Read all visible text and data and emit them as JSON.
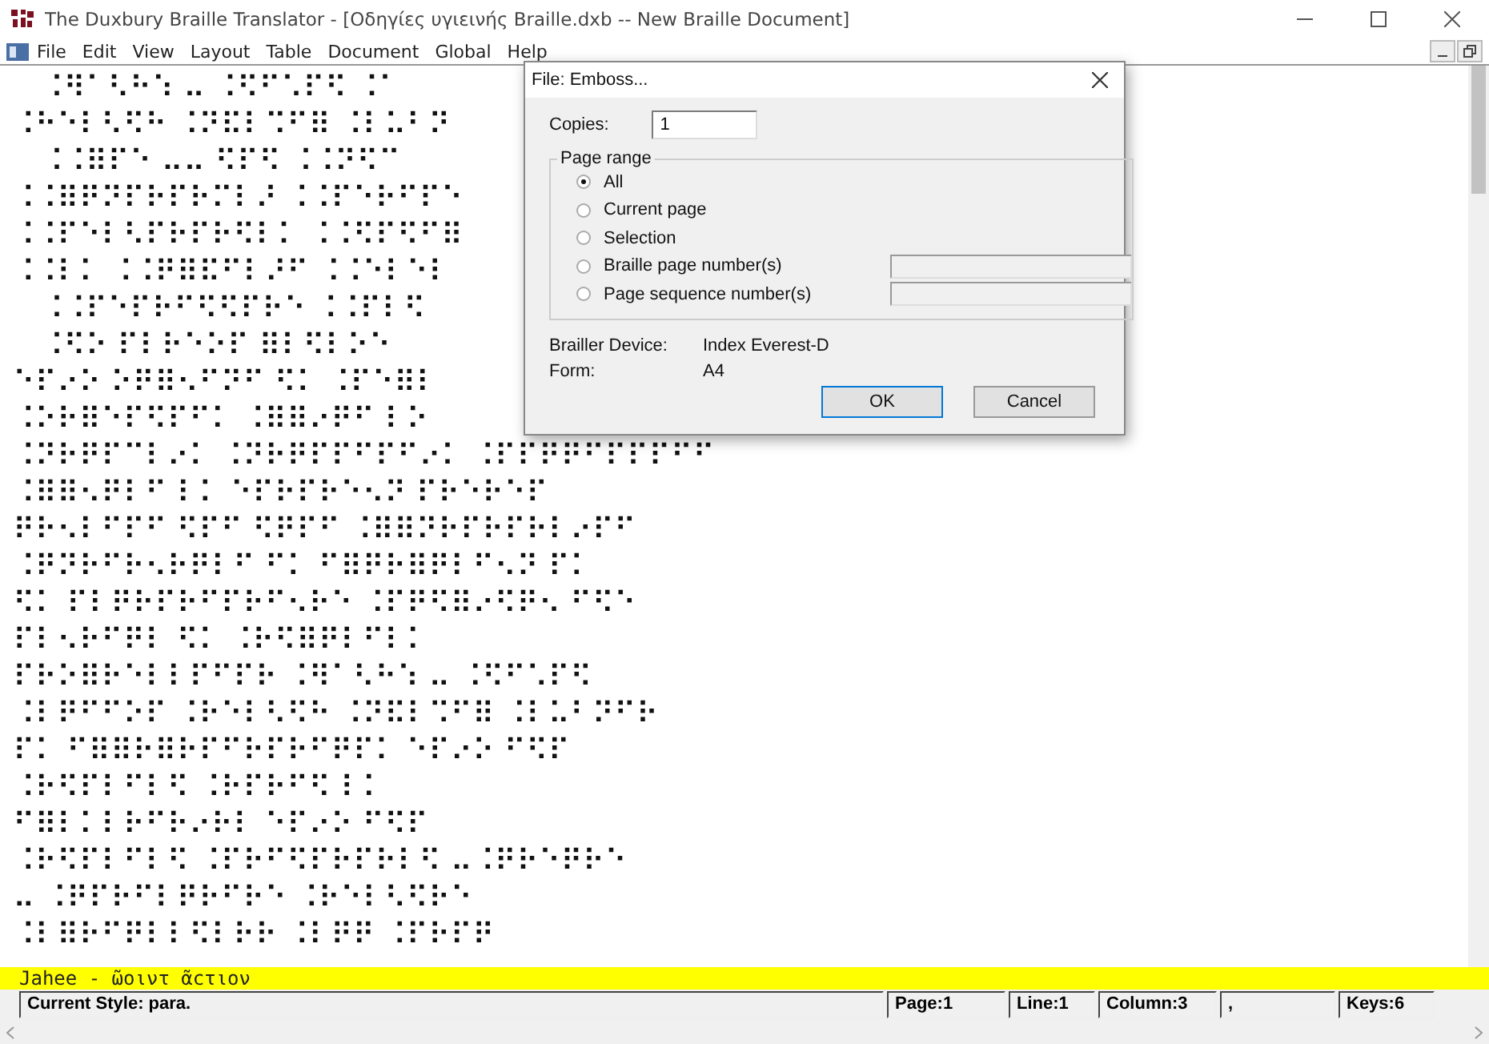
{
  "window": {
    "title": "The Duxbury Braille Translator - [Οδηγίες υγιεινής Braille.dxb -- New Braille Document]"
  },
  "menu": [
    "File",
    "Edit",
    "View",
    "Layout",
    "Table",
    "Document",
    "Global",
    "Help"
  ],
  "document": {
    "lines": [
      "   ⠨⠻⠁⠣⠓⠱ ⠤ ⠨⠫⠋⠡⠏⠫ ⠨⠁",
      "⠨⠓⠑⠇⠣⠫⠓ ⠨⠝⠯⠇⠩⠋⠿ ⠨⠇⠥⠃⠝",
      "   ⠨⠨⠿⠏⠑ ⠤⠤ ⠫⠏⠫ ⠨⠨⠝⠫⠉",
      "⠨⠨⠿⠟⠝⠏⠗⠏⠗⠍⠇⠜ ⠨⠨⠏⠑⠗⠋⠏⠑",
      "⠨⠨⠏⠑⠇⠣⠏⠗⠏⠗⠫⠇⠅ ⠨⠨⠫⠏⠫⠋⠿",
      "⠨⠨⠇⠅ ⠨⠨⠟⠿⠯⠋⠇⠜⠋ ⠨⠨⠑⠇⠑⠇",
      "   ⠨⠨⠏⠑⠏⠗⠋⠫⠫⠏⠗⠑ ⠨⠨⠏⠇⠫",
      "   ⠨⠫⠕ ⠏⠇⠗⠑⠕⠏ ⠿⠇⠫⠇⠕⠑",
      "⠑⠏⠔⠕ ⠕⠟⠿⠢⠋⠝⠋ ⠫⠅ ⠨⠏⠑⠿⠇",
      "⠨⠕⠗⠿⠑⠏⠫⠏⠋⠅ ⠨⠿⠿⠔⠟⠋ ⠇⠕",
      "⠨⠝⠗⠟⠏⠉⠇⠔⠅ ⠨⠝⠗⠟⠏⠏⠋⠏⠋⠔⠅ ⠨⠏⠏⠟⠟⠋⠏⠏⠏⠋⠋",
      "⠨⠿⠿⠢⠟⠇⠋ ⠇⠅ ⠑⠏⠗⠏⠗⠑⠢⠝ ⠏⠗⠑⠗⠑⠏",
      "⠟⠗⠢⠇⠋⠏⠋ ⠫⠏⠋ ⠫⠟⠏⠋ ⠨⠿⠿⠝⠗⠏⠗⠏⠗⠇⠔⠏⠋",
      "⠨⠟⠝⠗⠋⠗⠢⠗⠟⠇⠋ ⠋⠅ ⠋⠿⠟⠗⠿⠟⠇⠋⠢⠝ ⠏⠅",
      "⠫⠅ ⠏⠇⠟⠗⠏⠗⠋⠏⠗⠋⠢⠗⠑ ⠨⠏⠟⠫⠿⠔⠫⠟⠢ ⠋⠫⠑",
      "⠏⠇⠢⠗⠋⠟⠇ ⠫⠅ ⠨⠗⠫⠿⠟⠇⠋⠇⠅",
      "⠏⠗⠕⠿⠗⠑⠇⠇⠏⠋⠏⠗ ⠨⠻⠁⠣⠓⠱ ⠤ ⠨⠫⠋⠡⠏⠫",
      "⠨⠇⠟⠋⠋⠕⠏ ⠨⠗⠑⠇⠣⠫⠓ ⠨⠝⠯⠇⠩⠋⠿ ⠨⠇⠥⠃⠝⠋⠗",
      "⠏⠅ ⠋⠿⠿⠗⠿⠗⠏⠋⠗⠏⠗⠋⠟⠏⠅ ⠑⠏⠔⠕ ⠋⠫⠏",
      "⠨⠗⠫⠏⠇⠋⠇⠫ ⠨⠗⠏⠗⠋⠫ ⠇⠅",
      "⠋⠿⠇⠅⠇⠗⠋⠗⠔⠗⠇ ⠑⠏⠔⠕ ⠋⠫⠏",
      "⠨⠗⠫⠏⠇⠋⠇⠫ ⠨⠏⠗⠋⠫⠏⠗⠏⠗⠇⠫ ⠤⠨⠟⠗⠑⠟⠗⠑",
      "⠤ ⠨⠟⠏⠗⠋⠇⠟⠗⠋⠗⠑ ⠨⠗⠑⠇⠣⠫⠗⠑",
      "⠨⠇⠿⠗⠋⠟⠇⠇⠫⠇⠗⠗ ⠨⠇⠟⠟ ⠨⠏⠗⠏⠟"
    ]
  },
  "dialog": {
    "title": "File: Emboss...",
    "copies": {
      "label": "Copies:",
      "value": "1"
    },
    "page_range": {
      "label": "Page range",
      "options": [
        {
          "label": "All",
          "selected": true,
          "kind": "plain"
        },
        {
          "label": "Current page",
          "selected": false,
          "kind": "plain"
        },
        {
          "label": "Selection",
          "selected": false,
          "kind": "plain"
        },
        {
          "label": "Braille page number(s)",
          "selected": false,
          "kind": "field"
        },
        {
          "label": "Page sequence number(s)",
          "selected": false,
          "kind": "field"
        }
      ]
    },
    "info": [
      {
        "label": "Brailler Device:",
        "value": "Index Everest-D"
      },
      {
        "label": "Form:",
        "value": "A4"
      }
    ],
    "buttons": [
      "OK",
      "Cancel"
    ]
  },
  "print_line": "Jahee - ῶοιντ ᾶϲτιον",
  "status_bar": [
    "Current Style: para.",
    "Page:1",
    "Line:1",
    "Column:3",
    ",",
    "Keys:6"
  ]
}
